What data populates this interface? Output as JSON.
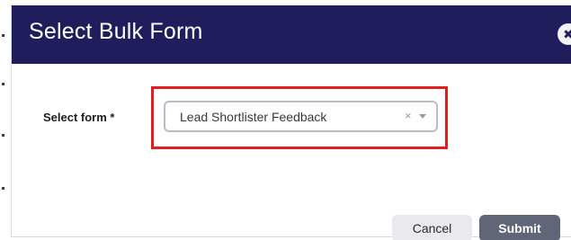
{
  "modal": {
    "title": "Select Bulk Form",
    "close_icon": "close-icon",
    "close_glyph": "✖"
  },
  "form": {
    "label": "Select form *",
    "select": {
      "value": "Lead Shortlister Feedback",
      "clear_glyph": "×",
      "clear_icon": "clear-icon",
      "arrow_icon": "chevron-down-icon"
    }
  },
  "actions": {
    "cancel_label": "Cancel",
    "submit_label": "Submit"
  },
  "colors": {
    "header_bg": "#201d5c",
    "highlight": "#e02020",
    "submit_bg": "#5f6677",
    "cancel_bg": "#e9e9ee"
  }
}
